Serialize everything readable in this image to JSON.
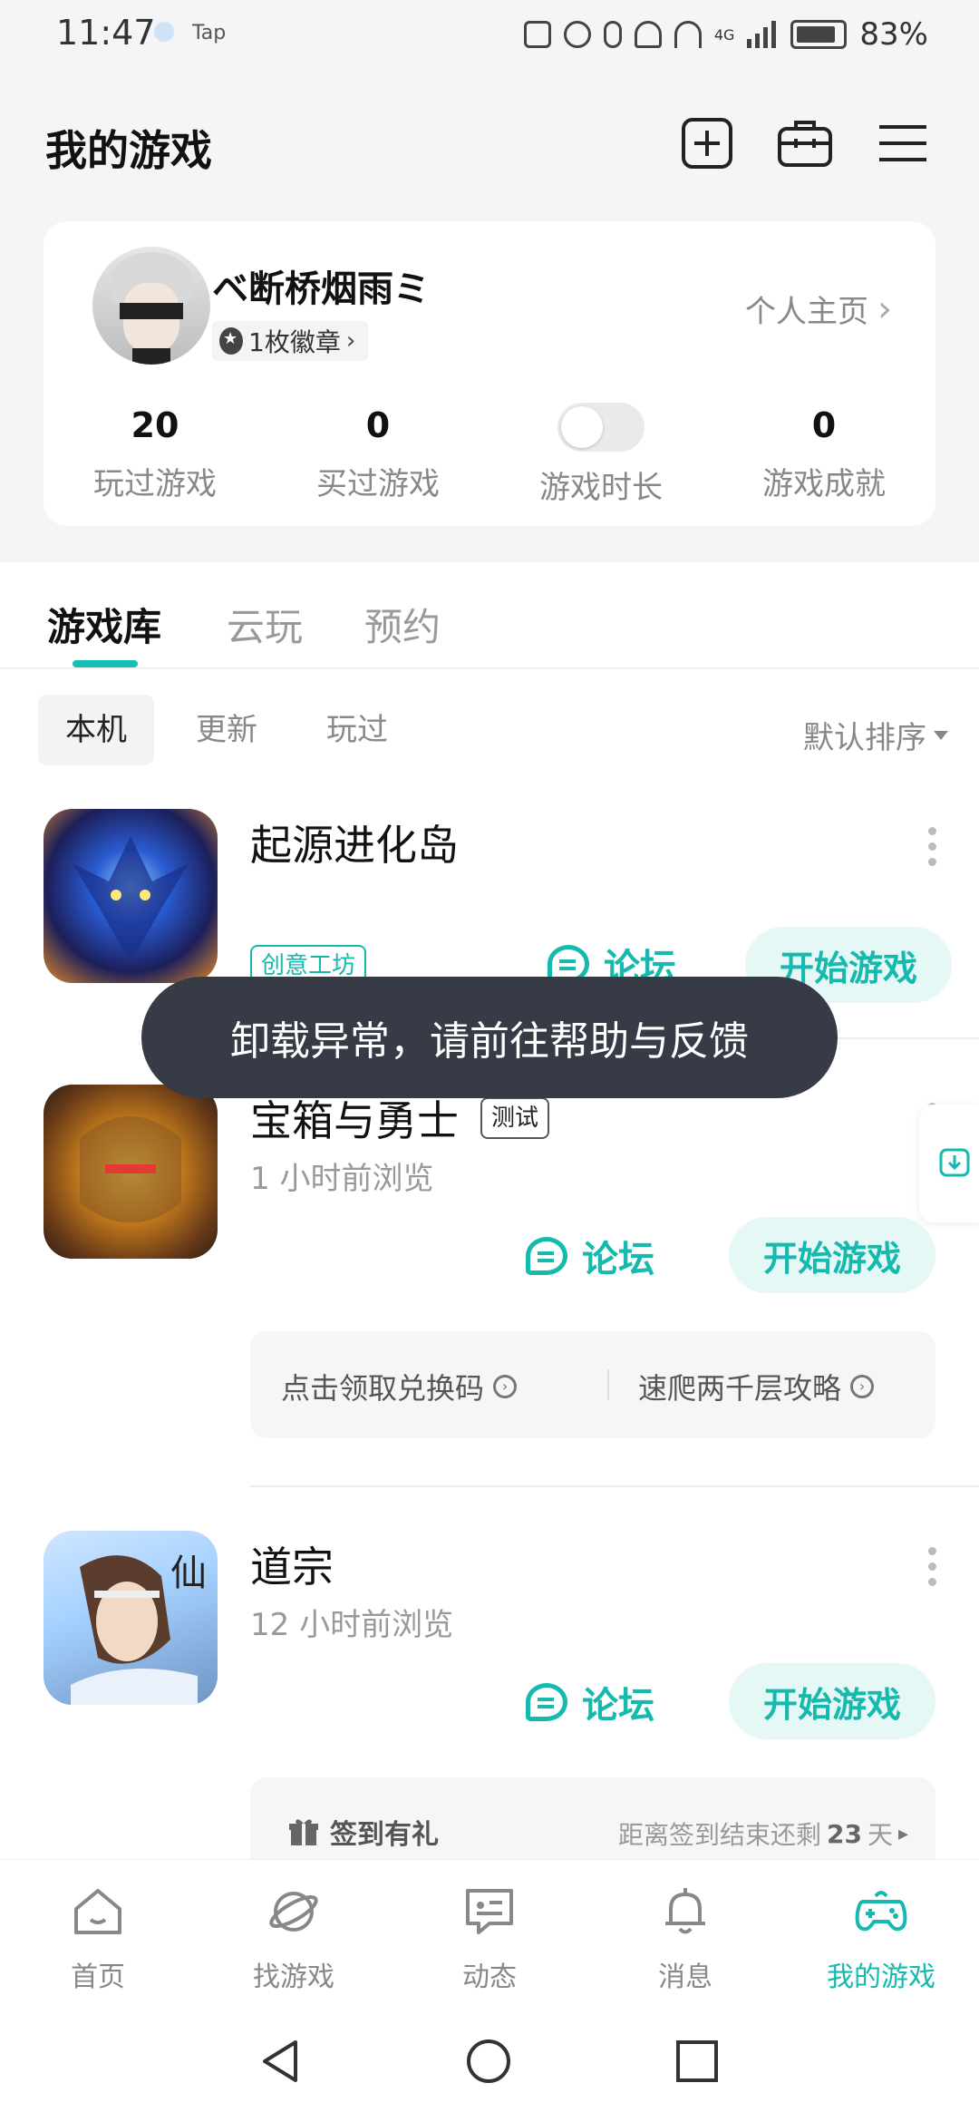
{
  "status_bar": {
    "time": "11:47",
    "app_label": "Tap",
    "battery": "83%",
    "network": "4G"
  },
  "header": {
    "title": "我的游戏"
  },
  "profile": {
    "name": "ベ断桥烟雨ミ",
    "badge": "1枚徽章",
    "homepage_link": "个人主页",
    "stats": [
      {
        "value": "20",
        "label": "玩过游戏"
      },
      {
        "value": "0",
        "label": "买过游戏"
      },
      {
        "value": "",
        "label": "游戏时长"
      },
      {
        "value": "0",
        "label": "游戏成就"
      }
    ]
  },
  "tabs": [
    "游戏库",
    "云玩",
    "预约"
  ],
  "filters": [
    "本机",
    "更新",
    "玩过"
  ],
  "sort_label": "默认排序",
  "games": [
    {
      "name": "起源进化岛",
      "tag": "创意工坊",
      "forum": "论坛",
      "start": "开始游戏"
    },
    {
      "name": "宝箱与勇士",
      "tag": "测试",
      "subtitle": "1 小时前浏览",
      "forum": "论坛",
      "start": "开始游戏",
      "promos": [
        "点击领取兑换码",
        "速爬两千层攻略"
      ]
    },
    {
      "name": "道宗",
      "subtitle": "12 小时前浏览",
      "forum": "论坛",
      "start": "开始游戏"
    }
  ],
  "checkin": {
    "label": "签到有礼",
    "remaining_prefix": "距离签到结束还剩",
    "days": "23",
    "unit": "天"
  },
  "toast": "卸载异常，请前往帮助与反馈",
  "bottom_nav": [
    "首页",
    "找游戏",
    "动态",
    "消息",
    "我的游戏"
  ],
  "accent_color": "#15b9ae"
}
